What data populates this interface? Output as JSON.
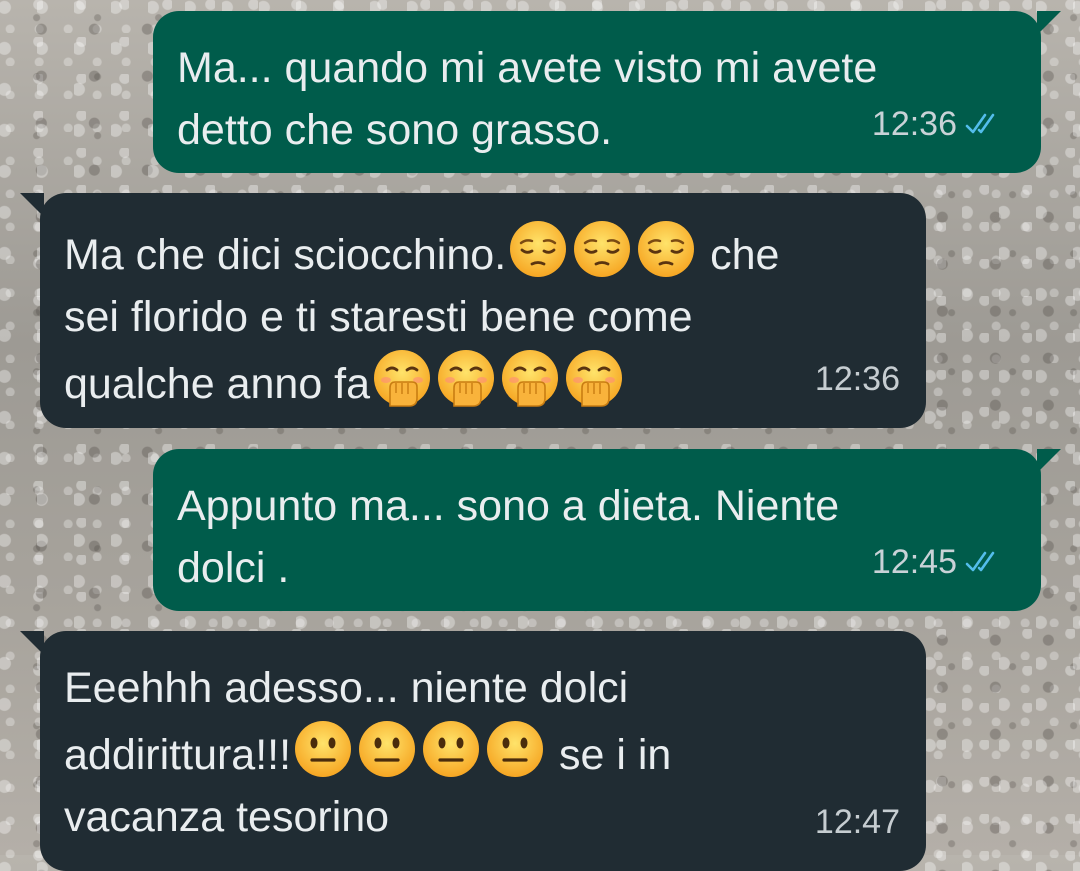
{
  "messages": [
    {
      "direction": "out",
      "lines": [
        [
          {
            "t": "text",
            "v": "Ma... quando mi avete visto mi avete"
          }
        ],
        [
          {
            "t": "text",
            "v": "detto che sono grasso."
          }
        ]
      ],
      "time": "12:36",
      "status": "read"
    },
    {
      "direction": "in",
      "lines": [
        [
          {
            "t": "text",
            "v": "Ma che dici sciocchino."
          },
          {
            "t": "emoji",
            "v": "pensive-face"
          },
          {
            "t": "emoji",
            "v": "pensive-face"
          },
          {
            "t": "emoji",
            "v": "pensive-face"
          },
          {
            "t": "text",
            "v": " che"
          }
        ],
        [
          {
            "t": "text",
            "v": "sei florido e ti staresti bene come"
          }
        ],
        [
          {
            "t": "text",
            "v": "qualche anno fa"
          },
          {
            "t": "emoji",
            "v": "hand-over-mouth-face"
          },
          {
            "t": "emoji",
            "v": "hand-over-mouth-face"
          },
          {
            "t": "emoji",
            "v": "hand-over-mouth-face"
          },
          {
            "t": "emoji",
            "v": "hand-over-mouth-face"
          }
        ]
      ],
      "time": "12:36"
    },
    {
      "direction": "out",
      "lines": [
        [
          {
            "t": "text",
            "v": "Appunto ma... sono a dieta. Niente"
          }
        ],
        [
          {
            "t": "text",
            "v": "dolci ."
          }
        ]
      ],
      "time": "12:45",
      "status": "read"
    },
    {
      "direction": "in",
      "lines": [
        [
          {
            "t": "text",
            "v": "Eeehhh adesso... niente dolci"
          }
        ],
        [
          {
            "t": "text",
            "v": "addirittura!!!"
          },
          {
            "t": "emoji",
            "v": "neutral-face"
          },
          {
            "t": "emoji",
            "v": "neutral-face"
          },
          {
            "t": "emoji",
            "v": "neutral-face"
          },
          {
            "t": "emoji",
            "v": "neutral-face"
          },
          {
            "t": "text",
            "v": " se i in"
          }
        ],
        [
          {
            "t": "text",
            "v": "vacanza tesorino"
          }
        ]
      ],
      "time": "12:47"
    }
  ],
  "colors": {
    "outgoing_bubble": "#005c4b",
    "incoming_bubble": "#202c33",
    "text": "#e9edef",
    "read_ticks": "#53bdeb"
  }
}
